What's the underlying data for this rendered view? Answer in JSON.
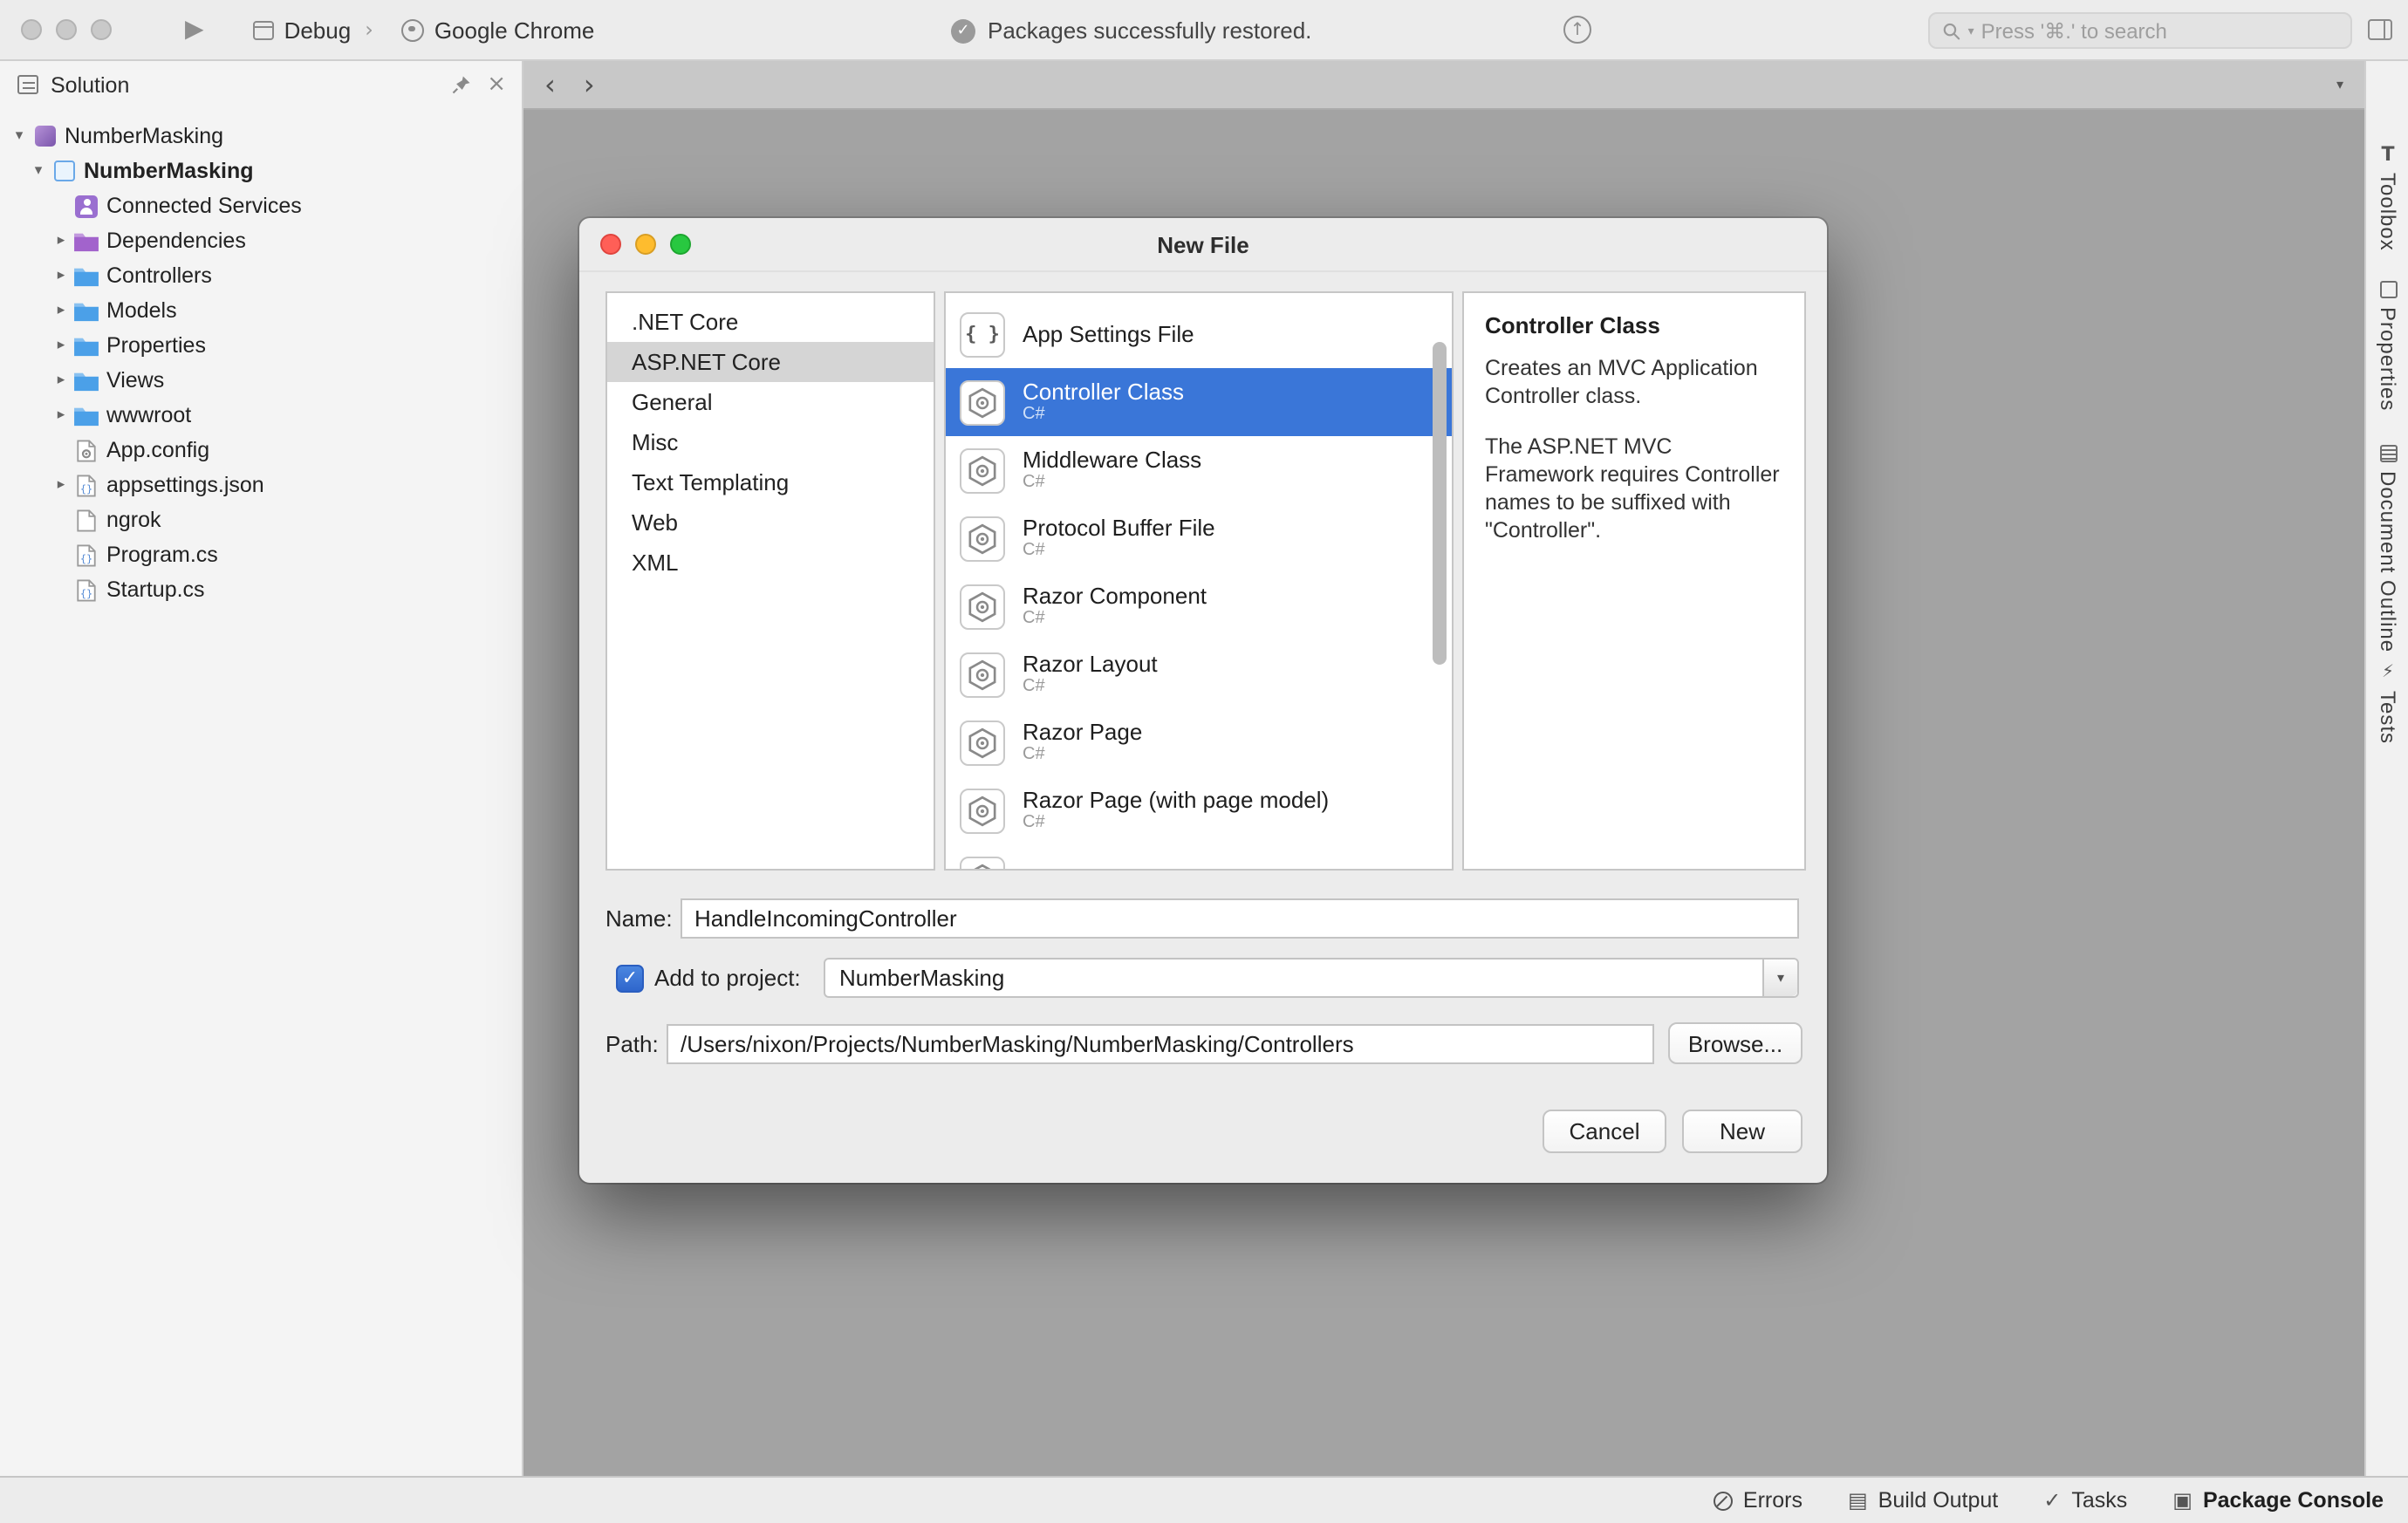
{
  "titlebar": {
    "scheme": "Debug",
    "separator": "›",
    "run_target": "Google Chrome",
    "status_message": "Packages successfully restored.",
    "search_placeholder": "Press '⌘.' to search"
  },
  "sidebar": {
    "title": "Solution",
    "tree": [
      {
        "label": "NumberMasking",
        "icon": "solution-icon"
      },
      {
        "label": "NumberMasking",
        "icon": "project-icon"
      },
      {
        "label": "Connected Services",
        "icon": "connected-services-icon"
      },
      {
        "label": "Dependencies",
        "icon": "folder-purple-icon"
      },
      {
        "label": "Controllers",
        "icon": "folder-icon"
      },
      {
        "label": "Models",
        "icon": "folder-icon"
      },
      {
        "label": "Properties",
        "icon": "folder-icon"
      },
      {
        "label": "Views",
        "icon": "folder-icon"
      },
      {
        "label": "wwwroot",
        "icon": "folder-icon"
      },
      {
        "label": "App.config",
        "icon": "config-file-icon"
      },
      {
        "label": "appsettings.json",
        "icon": "json-file-icon"
      },
      {
        "label": "ngrok",
        "icon": "file-icon"
      },
      {
        "label": "Program.cs",
        "icon": "csharp-file-icon"
      },
      {
        "label": "Startup.cs",
        "icon": "csharp-file-icon"
      }
    ]
  },
  "right_rail": {
    "items": [
      "Toolbox",
      "Properties",
      "Document Outline",
      "Tests"
    ]
  },
  "statusbar": {
    "items": [
      "Errors",
      "Build Output",
      "Tasks",
      "Package Console"
    ]
  },
  "dialog": {
    "title": "New File",
    "categories": [
      ".NET Core",
      "ASP.NET Core",
      "General",
      "Misc",
      "Text Templating",
      "Web",
      "XML"
    ],
    "selected_category": "ASP.NET Core",
    "templates": [
      {
        "name": "App Settings File",
        "lang": ""
      },
      {
        "name": "Controller Class",
        "lang": "C#"
      },
      {
        "name": "Middleware Class",
        "lang": "C#"
      },
      {
        "name": "Protocol Buffer File",
        "lang": "C#"
      },
      {
        "name": "Razor Component",
        "lang": "C#"
      },
      {
        "name": "Razor Layout",
        "lang": "C#"
      },
      {
        "name": "Razor Page",
        "lang": "C#"
      },
      {
        "name": "Razor Page (with page model)",
        "lang": "C#"
      }
    ],
    "selected_template": "Controller Class",
    "info": {
      "heading": "Controller Class",
      "description": "Creates an MVC Application Controller class.",
      "note": "The ASP.NET MVC Framework requires Controller names to be suffixed with \"Controller\"."
    },
    "name_label": "Name:",
    "name_value": "HandleIncomingController",
    "add_to_project_label": "Add to project:",
    "add_to_project_checked": true,
    "project_value": "NumberMasking",
    "path_label": "Path:",
    "path_value": "/Users/nixon/Projects/NumberMasking/NumberMasking/Controllers",
    "browse_label": "Browse...",
    "cancel_label": "Cancel",
    "new_label": "New"
  }
}
